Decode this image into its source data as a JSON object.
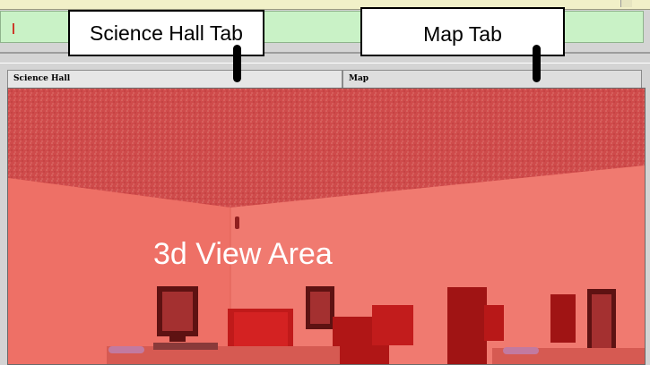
{
  "view": {
    "title": "3d View Area"
  },
  "tabs": [
    {
      "label": "Science Hall"
    },
    {
      "label": "Map"
    }
  ],
  "callouts": [
    {
      "label": "Science Hall Tab"
    },
    {
      "label": "Map Tab"
    }
  ],
  "colors": {
    "overlay": "#eb6a5e",
    "ceiling": "#cc4848",
    "input_bar": "#c9f2c6",
    "top_strip": "#f1f0c8"
  }
}
